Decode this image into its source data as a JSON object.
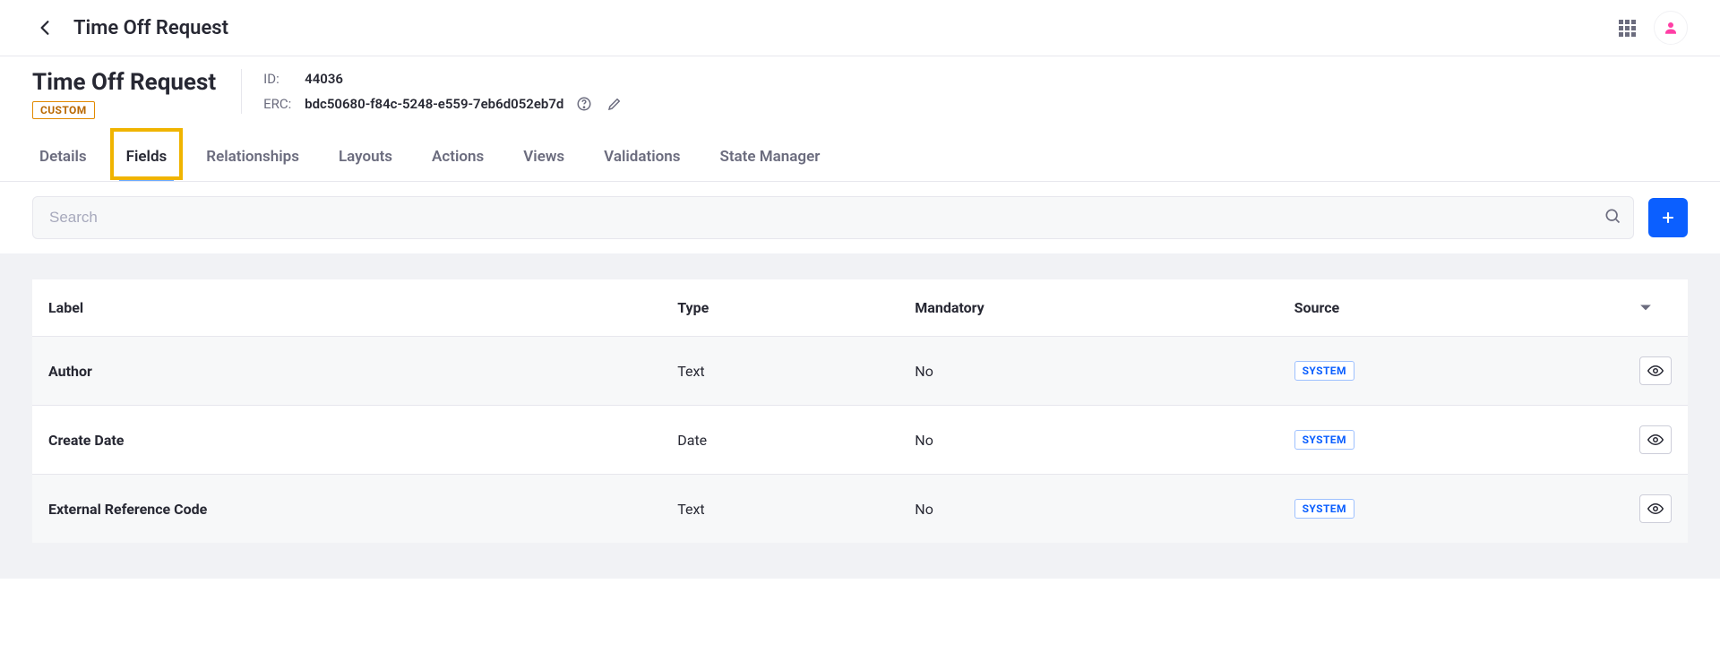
{
  "topbar": {
    "title": "Time Off Request"
  },
  "header": {
    "page_title": "Time Off Request",
    "custom_badge": "CUSTOM",
    "id_label": "ID:",
    "id_value": "44036",
    "erc_label": "ERC:",
    "erc_value": "bdc50680-f84c-5248-e559-7eb6d052eb7d"
  },
  "tabs": [
    {
      "label": "Details",
      "active": false
    },
    {
      "label": "Fields",
      "active": true,
      "highlight": true
    },
    {
      "label": "Relationships",
      "active": false
    },
    {
      "label": "Layouts",
      "active": false
    },
    {
      "label": "Actions",
      "active": false
    },
    {
      "label": "Views",
      "active": false
    },
    {
      "label": "Validations",
      "active": false
    },
    {
      "label": "State Manager",
      "active": false
    }
  ],
  "search": {
    "placeholder": "Search"
  },
  "table": {
    "columns": {
      "label": "Label",
      "type": "Type",
      "mandatory": "Mandatory",
      "source": "Source"
    },
    "rows": [
      {
        "label": "Author",
        "type": "Text",
        "mandatory": "No",
        "source": "SYSTEM"
      },
      {
        "label": "Create Date",
        "type": "Date",
        "mandatory": "No",
        "source": "SYSTEM"
      },
      {
        "label": "External Reference Code",
        "type": "Text",
        "mandatory": "No",
        "source": "SYSTEM"
      }
    ]
  },
  "colors": {
    "accent": "#0b5fff",
    "highlight": "#f0b400",
    "badge_border": "#e28a00"
  }
}
